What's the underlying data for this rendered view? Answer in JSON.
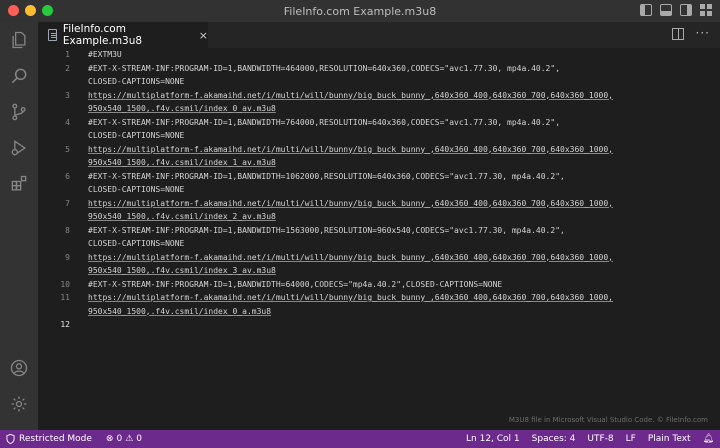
{
  "window": {
    "title": "FileInfo.com Example.m3u8"
  },
  "activity_bar": {
    "icons": [
      "explorer-icon",
      "search-icon",
      "source-control-icon",
      "run-debug-icon",
      "extensions-icon"
    ],
    "bottom_icons": [
      "account-icon",
      "settings-gear-icon"
    ]
  },
  "tab": {
    "label": "FileInfo.com Example.m3u8",
    "close_glyph": "×"
  },
  "editor": {
    "lines": [
      {
        "num": "1",
        "wrapped": [
          "#EXTM3U"
        ],
        "link": false
      },
      {
        "num": "2",
        "wrapped": [
          "#EXT-X-STREAM-INF:PROGRAM-ID=1,BANDWIDTH=464000,RESOLUTION=640x360,CODECS=\"avc1.77.30, mp4a.40.2\",",
          "CLOSED-CAPTIONS=NONE"
        ],
        "link": false
      },
      {
        "num": "3",
        "wrapped": [
          "https://multiplatform-f.akamaihd.net/i/multi/will/bunny/big_buck_bunny_,640x360_400,640x360_700,640x360_1000,",
          "950x540_1500,.f4v.csmil/index_0_av.m3u8"
        ],
        "link": true
      },
      {
        "num": "4",
        "wrapped": [
          "#EXT-X-STREAM-INF:PROGRAM-ID=1,BANDWIDTH=764000,RESOLUTION=640x360,CODECS=\"avc1.77.30, mp4a.40.2\",",
          "CLOSED-CAPTIONS=NONE"
        ],
        "link": false
      },
      {
        "num": "5",
        "wrapped": [
          "https://multiplatform-f.akamaihd.net/i/multi/will/bunny/big_buck_bunny_,640x360_400,640x360_700,640x360_1000,",
          "950x540_1500,.f4v.csmil/index_1_av.m3u8"
        ],
        "link": true
      },
      {
        "num": "6",
        "wrapped": [
          "#EXT-X-STREAM-INF:PROGRAM-ID=1,BANDWIDTH=1062000,RESOLUTION=640x360,CODECS=\"avc1.77.30, mp4a.40.2\",",
          "CLOSED-CAPTIONS=NONE"
        ],
        "link": false
      },
      {
        "num": "7",
        "wrapped": [
          "https://multiplatform-f.akamaihd.net/i/multi/will/bunny/big_buck_bunny_,640x360_400,640x360_700,640x360_1000,",
          "950x540_1500,.f4v.csmil/index_2_av.m3u8"
        ],
        "link": true
      },
      {
        "num": "8",
        "wrapped": [
          "#EXT-X-STREAM-INF:PROGRAM-ID=1,BANDWIDTH=1563000,RESOLUTION=960x540,CODECS=\"avc1.77.30, mp4a.40.2\",",
          "CLOSED-CAPTIONS=NONE"
        ],
        "link": false
      },
      {
        "num": "9",
        "wrapped": [
          "https://multiplatform-f.akamaihd.net/i/multi/will/bunny/big_buck_bunny_,640x360_400,640x360_700,640x360_1000,",
          "950x540_1500,.f4v.csmil/index_3_av.m3u8"
        ],
        "link": true
      },
      {
        "num": "10",
        "wrapped": [
          "#EXT-X-STREAM-INF:PROGRAM-ID=1,BANDWIDTH=64000,CODECS=\"mp4a.40.2\",CLOSED-CAPTIONS=NONE"
        ],
        "link": false
      },
      {
        "num": "11",
        "wrapped": [
          "https://multiplatform-f.akamaihd.net/i/multi/will/bunny/big_buck_bunny_,640x360_400,640x360_700,640x360_1000,",
          "950x540_1500,.f4v.csmil/index_0_a.m3u8"
        ],
        "link": true
      },
      {
        "num": "12",
        "wrapped": [
          ""
        ],
        "link": false,
        "active": true
      }
    ],
    "watermark": "M3U8 file in Microsoft Visual Studio Code. © FileInfo.com"
  },
  "status_bar": {
    "restricted_mode": "Restricted Mode",
    "errors": "0",
    "warnings": "0",
    "position": "Ln 12, Col 1",
    "spaces": "Spaces: 4",
    "encoding": "UTF-8",
    "eol": "LF",
    "language": "Plain Text",
    "accent_color": "#6c2a8c"
  }
}
